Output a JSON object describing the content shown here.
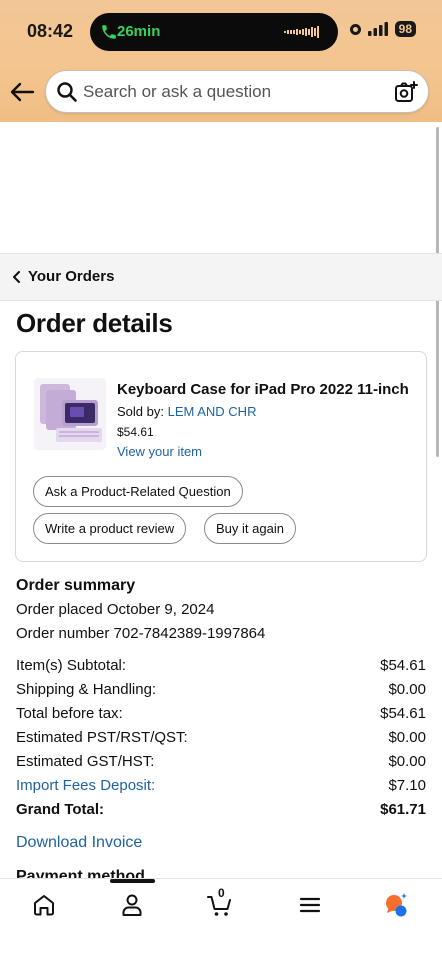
{
  "status": {
    "time": "08:42",
    "call_duration": "26min",
    "battery": "98"
  },
  "search": {
    "placeholder": "Search or ask a question"
  },
  "breadcrumb": {
    "label": "Your Orders"
  },
  "page": {
    "title": "Order details"
  },
  "product": {
    "title": "Keyboard Case for iPad Pro 2022 11-inch",
    "sold_by_label": "Sold by:",
    "seller": "LEM AND CHR",
    "price": "$54.61",
    "view_item": "View your item",
    "actions": {
      "ask": "Ask a Product-Related Question",
      "review": "Write a product review",
      "buy_again": "Buy it again"
    }
  },
  "summary": {
    "title": "Order summary",
    "placed": "Order placed October 9, 2024",
    "number": "Order number 702-7842389-1997864",
    "rows": [
      {
        "label": "Item(s) Subtotal:",
        "value": "$54.61"
      },
      {
        "label": "Shipping & Handling:",
        "value": "$0.00"
      },
      {
        "label": "Total before tax:",
        "value": "$54.61"
      },
      {
        "label": "Estimated PST/RST/QST:",
        "value": "$0.00"
      },
      {
        "label": "Estimated GST/HST:",
        "value": "$0.00"
      },
      {
        "label": "Import Fees Deposit:",
        "value": "$7.10"
      },
      {
        "label": "Grand Total:",
        "value": "$61.71"
      }
    ],
    "download_invoice": "Download Invoice",
    "payment_method_peek": "Payment method"
  },
  "bottom_nav": {
    "cart_count": "0"
  },
  "colors": {
    "header": "#f4c58f",
    "link": "#2162a1",
    "call_green": "#35d35b",
    "assistant_orange": "#f76f2d",
    "assistant_blue": "#1a73e8"
  }
}
